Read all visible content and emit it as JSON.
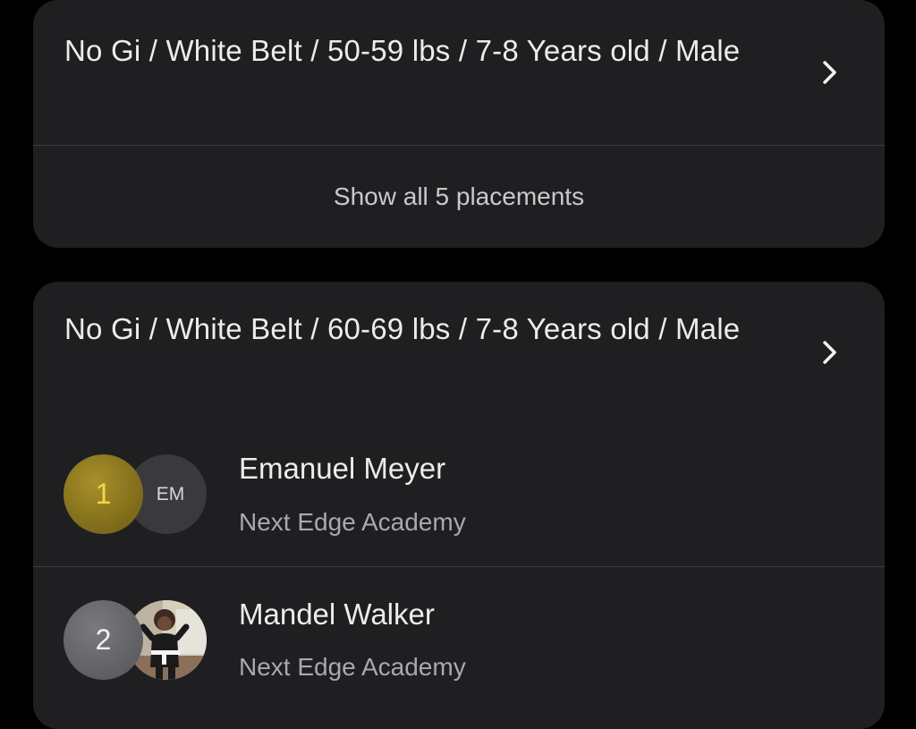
{
  "divisions": [
    {
      "title": "No Gi / White Belt / 50-59 lbs / 7-8 Years old / Male",
      "show_all_label": "Show all 5 placements"
    },
    {
      "title": "No Gi / White Belt / 60-69 lbs / 7-8 Years old / Male",
      "placements": [
        {
          "rank": "1",
          "initials": "EM",
          "name": "Emanuel Meyer",
          "academy": "Next Edge Academy"
        },
        {
          "rank": "2",
          "name": "Mandel Walker",
          "academy": "Next Edge Academy"
        }
      ]
    }
  ],
  "icons": {
    "chevron": "chevron-right-icon"
  },
  "colors": {
    "background": "#000000",
    "card": "#1f1f21",
    "gold": "#f4d64b",
    "silver": "#6b6b6f"
  }
}
